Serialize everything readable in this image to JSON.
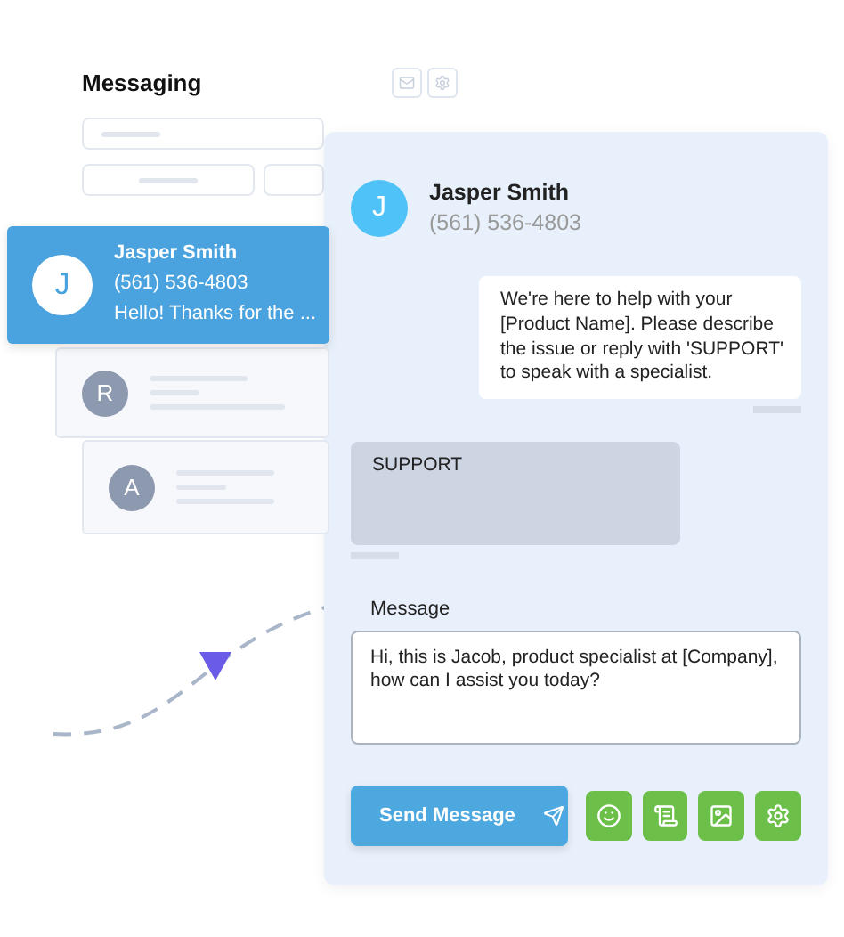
{
  "inbox": {
    "title": "Messaging"
  },
  "contacts": [
    {
      "initial": "J",
      "name": "Jasper Smith",
      "phone": "(561) 536-4803",
      "preview": "Hello! Thanks for the ...",
      "selected": true
    },
    {
      "initial": "R",
      "selected": false
    },
    {
      "initial": "A",
      "selected": false
    }
  ],
  "chat": {
    "initial": "J",
    "name": "Jasper Smith",
    "phone": "(561) 536-4803",
    "messages": [
      {
        "kind": "sent",
        "text": "We're here to help with your [Product Name]. Please describe the issue or reply with 'SUPPORT' to speak with a specialist."
      },
      {
        "kind": "received",
        "text": "SUPPORT"
      }
    ],
    "composer": {
      "label": "Message",
      "value": "Hi, this is Jacob, product specialist at [Company], how can I assist you today?"
    },
    "send_button": "Send Message"
  }
}
